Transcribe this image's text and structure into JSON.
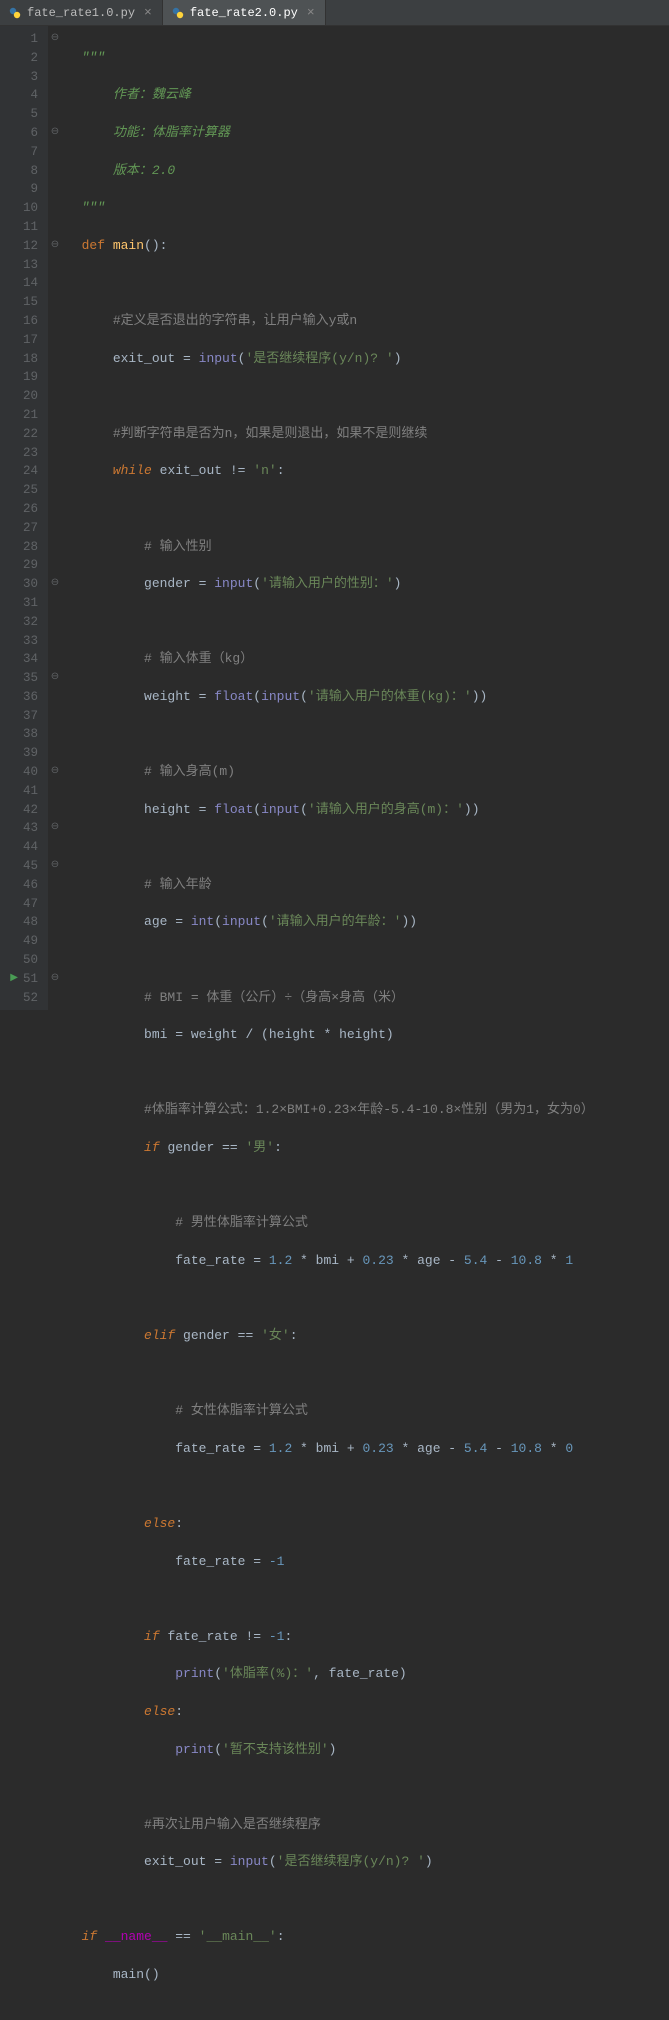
{
  "tabs": [
    {
      "label": "fate_rate1.0.py",
      "active": false
    },
    {
      "label": "fate_rate2.0.py",
      "active": true
    }
  ],
  "lineCount": 52,
  "runMarkerLine": 51,
  "code": {
    "l1": "\"\"\"",
    "l2a": "作者：魏云峰",
    "l3a": "功能：体脂率计算器",
    "l4a": "版本：2.0",
    "l5": "\"\"\"",
    "def": "def",
    "main": "main",
    "paren": "():",
    "l8c": "#定义是否退出的字符串，让用户输入y或n",
    "l9_var": "exit_out",
    "eq": " = ",
    "input": "input",
    "l9_str": "'是否继续程序(y/n)? '",
    "l11c": "#判断字符串是否为n，如果是则退出，如果不是则继续",
    "while": "while",
    "ne": " != ",
    "n_str": "'n'",
    "colon": ":",
    "l14c": "# 输入性别",
    "gender": "gender",
    "l15_str": "'请输入用户的性别：'",
    "l17c": "# 输入体重（kg）",
    "weight": "weight",
    "float": "float",
    "l18_str": "'请输入用户的体重(kg)：'",
    "l20c": "# 输入身高(m)",
    "height": "height",
    "l21_str": "'请输入用户的身高(m)：'",
    "l23c": "# 输入年龄",
    "age": "age",
    "int": "int",
    "l24_str": "'请输入用户的年龄：'",
    "l26c": "# BMI = 体重（公斤）÷（身高×身高（米）",
    "bmi": "bmi",
    "div": " / ",
    "mul": " * ",
    "l29c": "#体脂率计算公式：1.2×BMI+0.23×年龄-5.4-10.8×性别（男为1，女为0）",
    "if": "if",
    "eqeq": " == ",
    "male": "'男'",
    "l32c": "# 男性体脂率计算公式",
    "fate_rate": "fate_rate",
    "n1_2": "1.2",
    "n0_23": "0.23",
    "n5_4": "5.4",
    "n10_8": "10.8",
    "n1": "1",
    "n0": "0",
    "nm1": "-1",
    "plus": " + ",
    "minus": " - ",
    "elif": "elif",
    "female": "'女'",
    "l37c": "# 女性体脂率计算公式",
    "else": "else",
    "print": "print",
    "l44_str": "'体脂率(%)：'",
    "comma": ", ",
    "l46_str": "'暂不支持该性别'",
    "l48c": "#再次让用户输入是否继续程序",
    "name": "__name__",
    "main_str": "'__main__'",
    "maincall": "main()"
  }
}
